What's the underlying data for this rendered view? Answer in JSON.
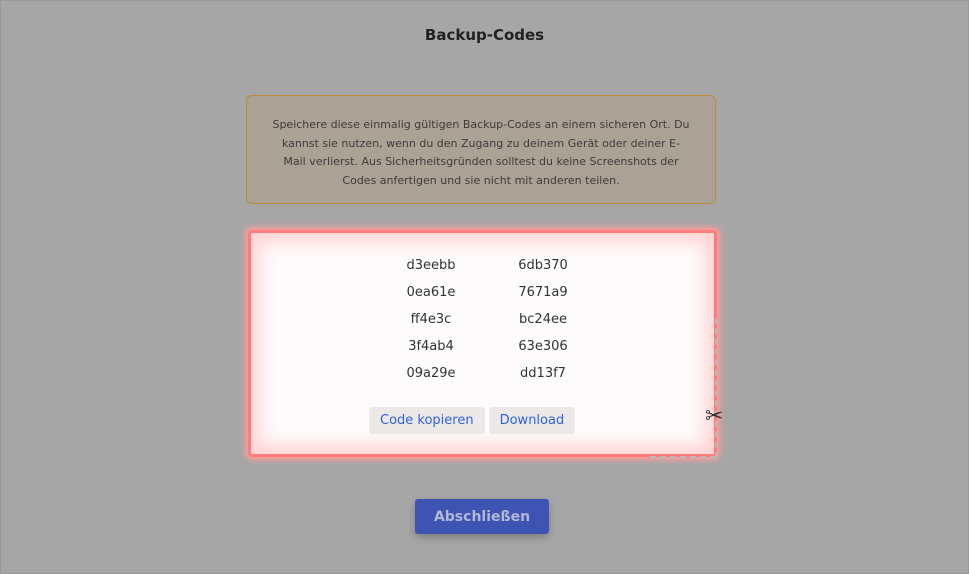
{
  "page": {
    "title": "Backup-Codes"
  },
  "notice": {
    "lines": [
      "Speichere diese einmalig gültigen Backup-Codes an einem sicheren Ort. Du",
      "kannst sie nutzen, wenn du den Zugang zu deinem Gerät oder deiner E-",
      "Mail verlierst. Aus Sicherheitsgründen solltest du keine Screenshots der",
      "Codes anfertigen und sie nicht mit anderen teilen."
    ]
  },
  "codes": [
    "d3eebb",
    "6db370",
    "0ea61e",
    "7671a9",
    "ff4e3c",
    "bc24ee",
    "3f4ab4",
    "63e306",
    "09a29e",
    "dd13f7"
  ],
  "actions": {
    "copy_label": "Code kopieren",
    "download_label": "Download"
  },
  "footer": {
    "finish_label": "Abschließen"
  },
  "icons": {
    "scissors": "✂"
  },
  "colors": {
    "accent": "#3e53b2",
    "link": "#2f62d8",
    "highlight": "#ff7c7c",
    "notice_border": "#b78e3a"
  }
}
